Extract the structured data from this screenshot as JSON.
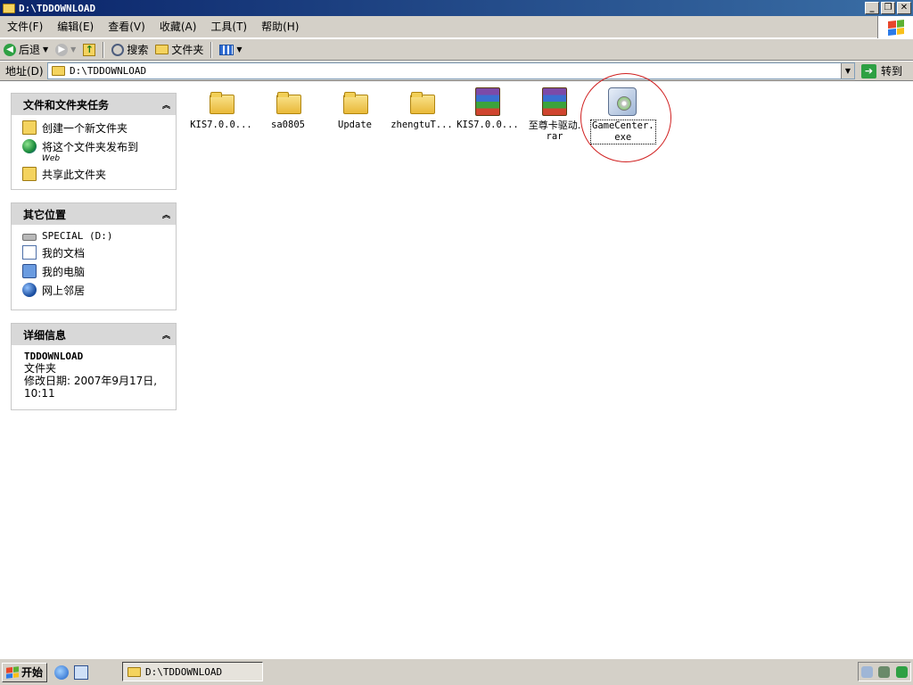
{
  "window": {
    "title": "D:\\TDDOWNLOAD",
    "minimize": "_",
    "restore": "❐",
    "close": "✕"
  },
  "menu": [
    {
      "label": "文件(F)"
    },
    {
      "label": "编辑(E)"
    },
    {
      "label": "查看(V)"
    },
    {
      "label": "收藏(A)"
    },
    {
      "label": "工具(T)"
    },
    {
      "label": "帮助(H)"
    }
  ],
  "toolbar": {
    "back": "后退",
    "search": "搜索",
    "folders": "文件夹"
  },
  "address": {
    "label": "地址(D)",
    "value": "D:\\TDDOWNLOAD",
    "go": "转到"
  },
  "tasks_panel": {
    "title": "文件和文件夹任务",
    "items": [
      {
        "label": "创建一个新文件夹",
        "sub": ""
      },
      {
        "label": "将这个文件夹发布到",
        "sub": "Web"
      },
      {
        "label": "共享此文件夹",
        "sub": ""
      }
    ]
  },
  "places_panel": {
    "title": "其它位置",
    "items": [
      {
        "label": "SPECIAL (D:)"
      },
      {
        "label": "我的文档"
      },
      {
        "label": "我的电脑"
      },
      {
        "label": "网上邻居"
      }
    ]
  },
  "details_panel": {
    "title": "详细信息",
    "name": "TDDOWNLOAD",
    "type": "文件夹",
    "modified_line1": "修改日期: 2007年9月17日,",
    "modified_line2": "10:11"
  },
  "files": [
    {
      "name": "KIS7.0.0...",
      "name2": "",
      "icon": "folder-icon"
    },
    {
      "name": "sa0805",
      "name2": "",
      "icon": "folder-icon"
    },
    {
      "name": "Update",
      "name2": "",
      "icon": "folder-icon"
    },
    {
      "name": "zhengtuT...",
      "name2": "",
      "icon": "folder-icon"
    },
    {
      "name": "KIS7.0.0...",
      "name2": "",
      "icon": "rar-archive-icon"
    },
    {
      "name": "至尊卡驱动.",
      "name2": "rar",
      "icon": "rar-archive-icon"
    },
    {
      "name": "GameCenter.",
      "name2": "exe",
      "icon": "installer-exe-icon"
    }
  ],
  "taskbar": {
    "start": "开始",
    "window_button": "D:\\TDDOWNLOAD"
  }
}
